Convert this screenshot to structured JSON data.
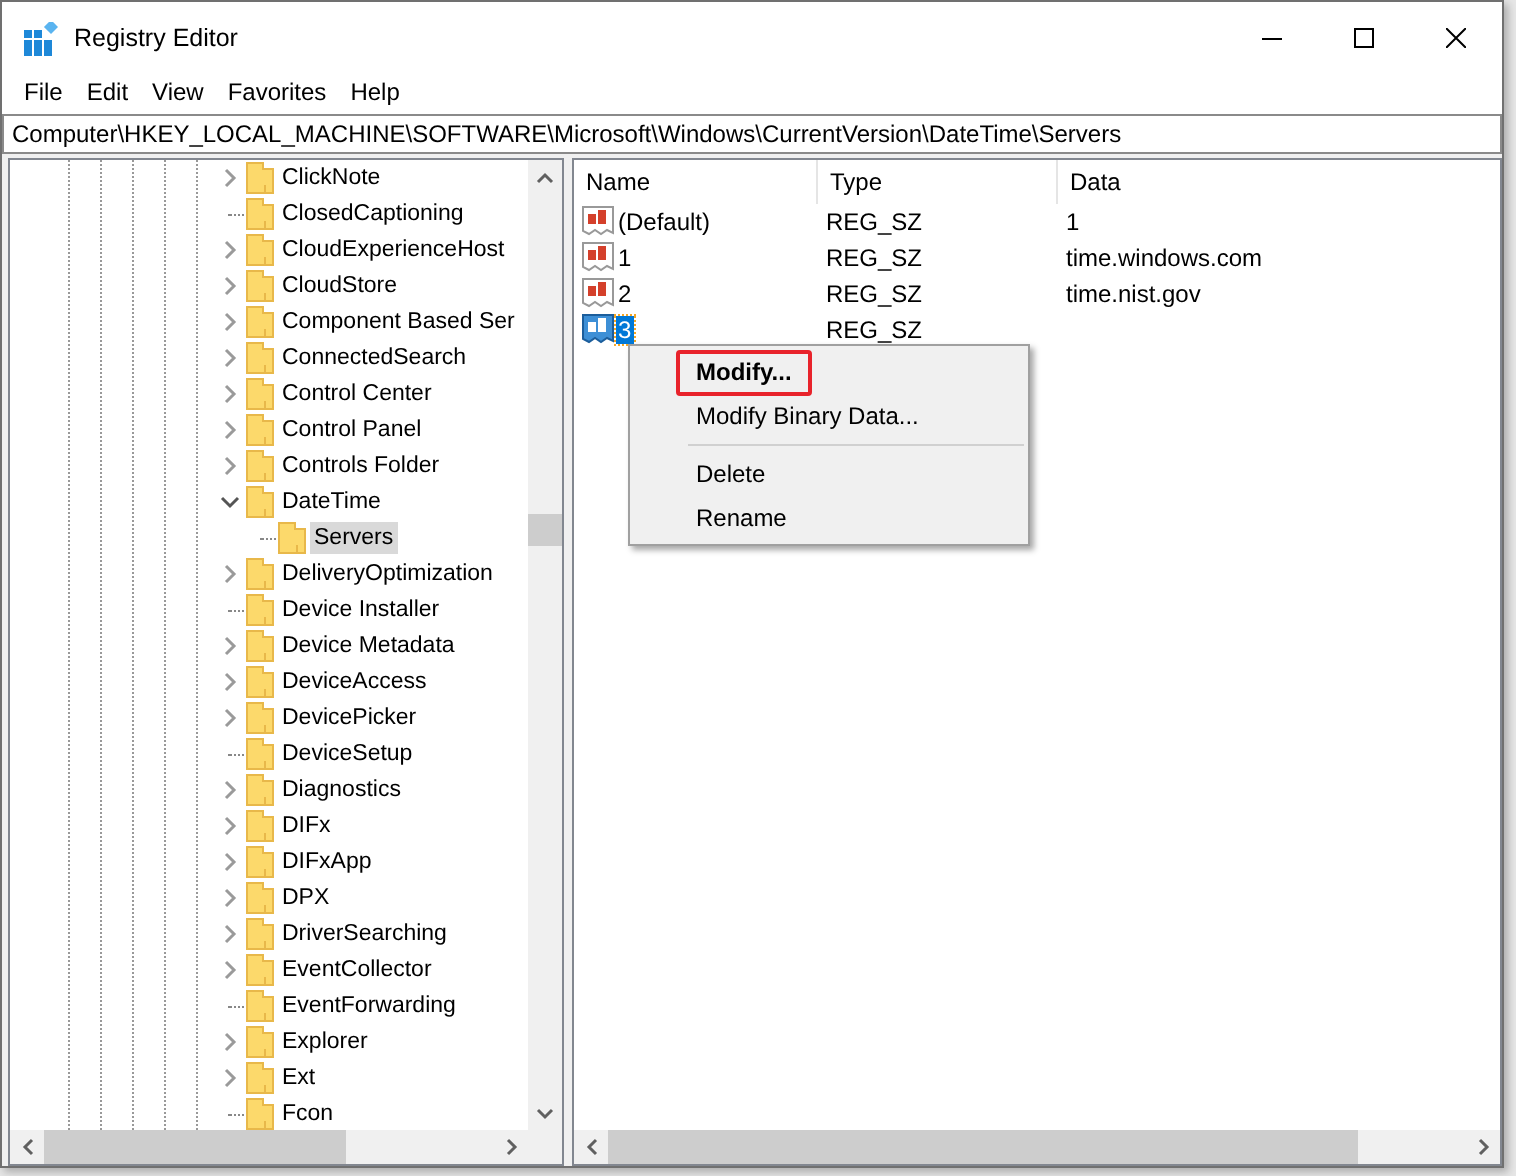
{
  "window": {
    "title": "Registry Editor"
  },
  "menu": [
    "File",
    "Edit",
    "View",
    "Favorites",
    "Help"
  ],
  "address": "Computer\\HKEY_LOCAL_MACHINE\\SOFTWARE\\Microsoft\\Windows\\CurrentVersion\\DateTime\\Servers",
  "tree": [
    {
      "label": "ClickNote",
      "has_children": true,
      "expanded": false,
      "selected": false
    },
    {
      "label": "ClosedCaptioning",
      "has_children": false,
      "selected": false
    },
    {
      "label": "CloudExperienceHost",
      "has_children": true,
      "expanded": false,
      "selected": false
    },
    {
      "label": "CloudStore",
      "has_children": true,
      "expanded": false,
      "selected": false
    },
    {
      "label": "Component Based Ser",
      "has_children": true,
      "expanded": false,
      "selected": false
    },
    {
      "label": "ConnectedSearch",
      "has_children": true,
      "expanded": false,
      "selected": false
    },
    {
      "label": "Control Center",
      "has_children": true,
      "expanded": false,
      "selected": false
    },
    {
      "label": "Control Panel",
      "has_children": true,
      "expanded": false,
      "selected": false
    },
    {
      "label": "Controls Folder",
      "has_children": true,
      "expanded": false,
      "selected": false
    },
    {
      "label": "DateTime",
      "has_children": true,
      "expanded": true,
      "selected": false,
      "children": [
        {
          "label": "Servers",
          "has_children": false,
          "selected": true
        }
      ]
    },
    {
      "label": "DeliveryOptimization",
      "has_children": true,
      "expanded": false,
      "selected": false
    },
    {
      "label": "Device Installer",
      "has_children": false,
      "selected": false
    },
    {
      "label": "Device Metadata",
      "has_children": true,
      "expanded": false,
      "selected": false
    },
    {
      "label": "DeviceAccess",
      "has_children": true,
      "expanded": false,
      "selected": false
    },
    {
      "label": "DevicePicker",
      "has_children": true,
      "expanded": false,
      "selected": false
    },
    {
      "label": "DeviceSetup",
      "has_children": false,
      "selected": false
    },
    {
      "label": "Diagnostics",
      "has_children": true,
      "expanded": false,
      "selected": false
    },
    {
      "label": "DIFx",
      "has_children": true,
      "expanded": false,
      "selected": false
    },
    {
      "label": "DIFxApp",
      "has_children": true,
      "expanded": false,
      "selected": false
    },
    {
      "label": "DPX",
      "has_children": true,
      "expanded": false,
      "selected": false
    },
    {
      "label": "DriverSearching",
      "has_children": true,
      "expanded": false,
      "selected": false
    },
    {
      "label": "EventCollector",
      "has_children": true,
      "expanded": false,
      "selected": false
    },
    {
      "label": "EventForwarding",
      "has_children": false,
      "selected": false
    },
    {
      "label": "Explorer",
      "has_children": true,
      "expanded": false,
      "selected": false
    },
    {
      "label": "Ext",
      "has_children": true,
      "expanded": false,
      "selected": false
    },
    {
      "label": "Fcon",
      "has_children": false,
      "selected": false
    }
  ],
  "values": {
    "columns": [
      "Name",
      "Type",
      "Data"
    ],
    "rows": [
      {
        "name": "(Default)",
        "type": "REG_SZ",
        "data": "1",
        "selected": false
      },
      {
        "name": "1",
        "type": "REG_SZ",
        "data": "time.windows.com",
        "selected": false
      },
      {
        "name": "2",
        "type": "REG_SZ",
        "data": "time.nist.gov",
        "selected": false
      },
      {
        "name": "3",
        "type": "REG_SZ",
        "selected": true
      }
    ]
  },
  "context_menu": [
    {
      "kind": "item",
      "label": "Modify...",
      "default": true,
      "highlighted": true
    },
    {
      "kind": "item",
      "label": "Modify Binary Data...",
      "default": false,
      "highlighted": false
    },
    {
      "kind": "separator"
    },
    {
      "kind": "item",
      "label": "Delete",
      "default": false,
      "highlighted": false
    },
    {
      "kind": "item",
      "label": "Rename",
      "default": false,
      "highlighted": false
    }
  ]
}
